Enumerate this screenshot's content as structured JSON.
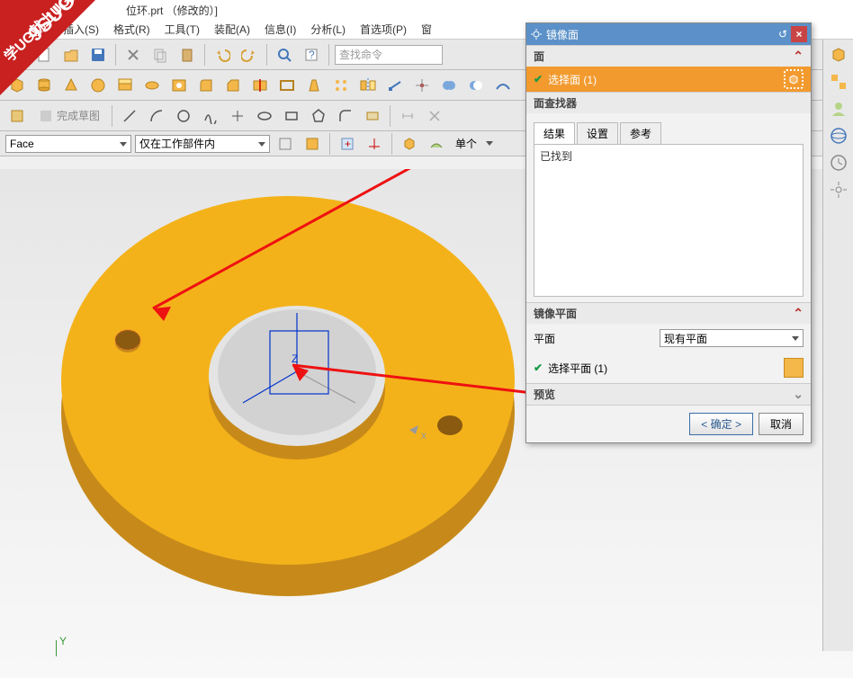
{
  "title_bar": "位环.prt （修改的）]",
  "menu": [
    "视图(V)",
    "插入(S)",
    "格式(R)",
    "工具(T)",
    "装配(A)",
    "信息(I)",
    "分析(L)",
    "首选项(P)",
    "窗"
  ],
  "search_placeholder": "查找命令",
  "sketch_finish": "完成草图",
  "filters": {
    "face": "Face",
    "scope": "仅在工作部件内",
    "single": "单个"
  },
  "dialog": {
    "title": "镜像面",
    "sections": {
      "face": "面",
      "finder": "面查找器",
      "plane": "镜像平面",
      "preview": "预览"
    },
    "select_face": "选择面 (1)",
    "tabs": [
      "结果",
      "设置",
      "参考"
    ],
    "found": "已找到",
    "plane_label": "平面",
    "plane_option": "现有平面",
    "select_plane": "选择平面 (1)",
    "ok": "< 确定 >",
    "cancel": "取消"
  },
  "watermark": {
    "main": "9SUG",
    "sub": "学UG就上UG网"
  },
  "axis_y": "Y"
}
